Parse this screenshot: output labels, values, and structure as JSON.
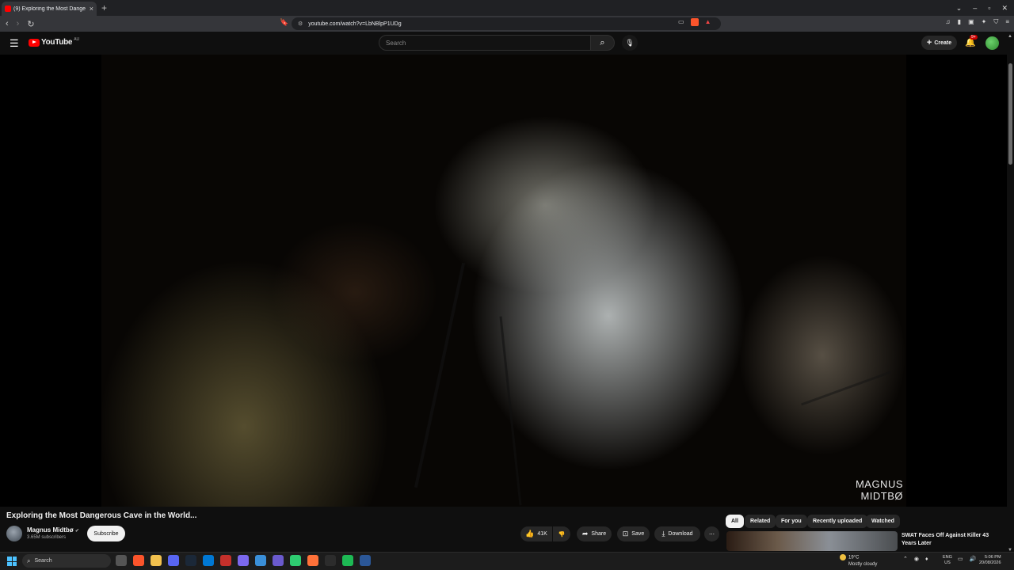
{
  "browser": {
    "tab_title": "(9) Exploring the Most Dange",
    "url": "youtube.com/watch?v=LbNBlpP1UDg"
  },
  "youtube": {
    "logo_text": "YouTube",
    "country_code": "AU",
    "search_placeholder": "Search",
    "create_label": "Create",
    "notification_count": "9+"
  },
  "video": {
    "title": "Exploring the Most Dangerous Cave in the World...",
    "watermark_line1": "MAGNUS",
    "watermark_line2": "MIDTBØ",
    "channel_name": "Magnus Midtbø",
    "subscribers": "3.65M subscribers",
    "subscribe_label": "Subscribe",
    "likes": "41K",
    "share_label": "Share",
    "save_label": "Save",
    "download_label": "Download"
  },
  "chips": [
    "All",
    "Related",
    "For you",
    "Recently uploaded",
    "Watched"
  ],
  "recommendation": {
    "title": "SWAT Faces Off Against Killer 43 Years Later"
  },
  "taskbar": {
    "search_label": "Search",
    "temperature": "19°C",
    "weather": "Mostly cloudy",
    "lang1": "ENG",
    "lang2": "US",
    "time": "5:06 PM",
    "date": "20/08/2026"
  },
  "colors": {
    "brand_red": "#ff0000",
    "background": "#0f0f0f"
  }
}
